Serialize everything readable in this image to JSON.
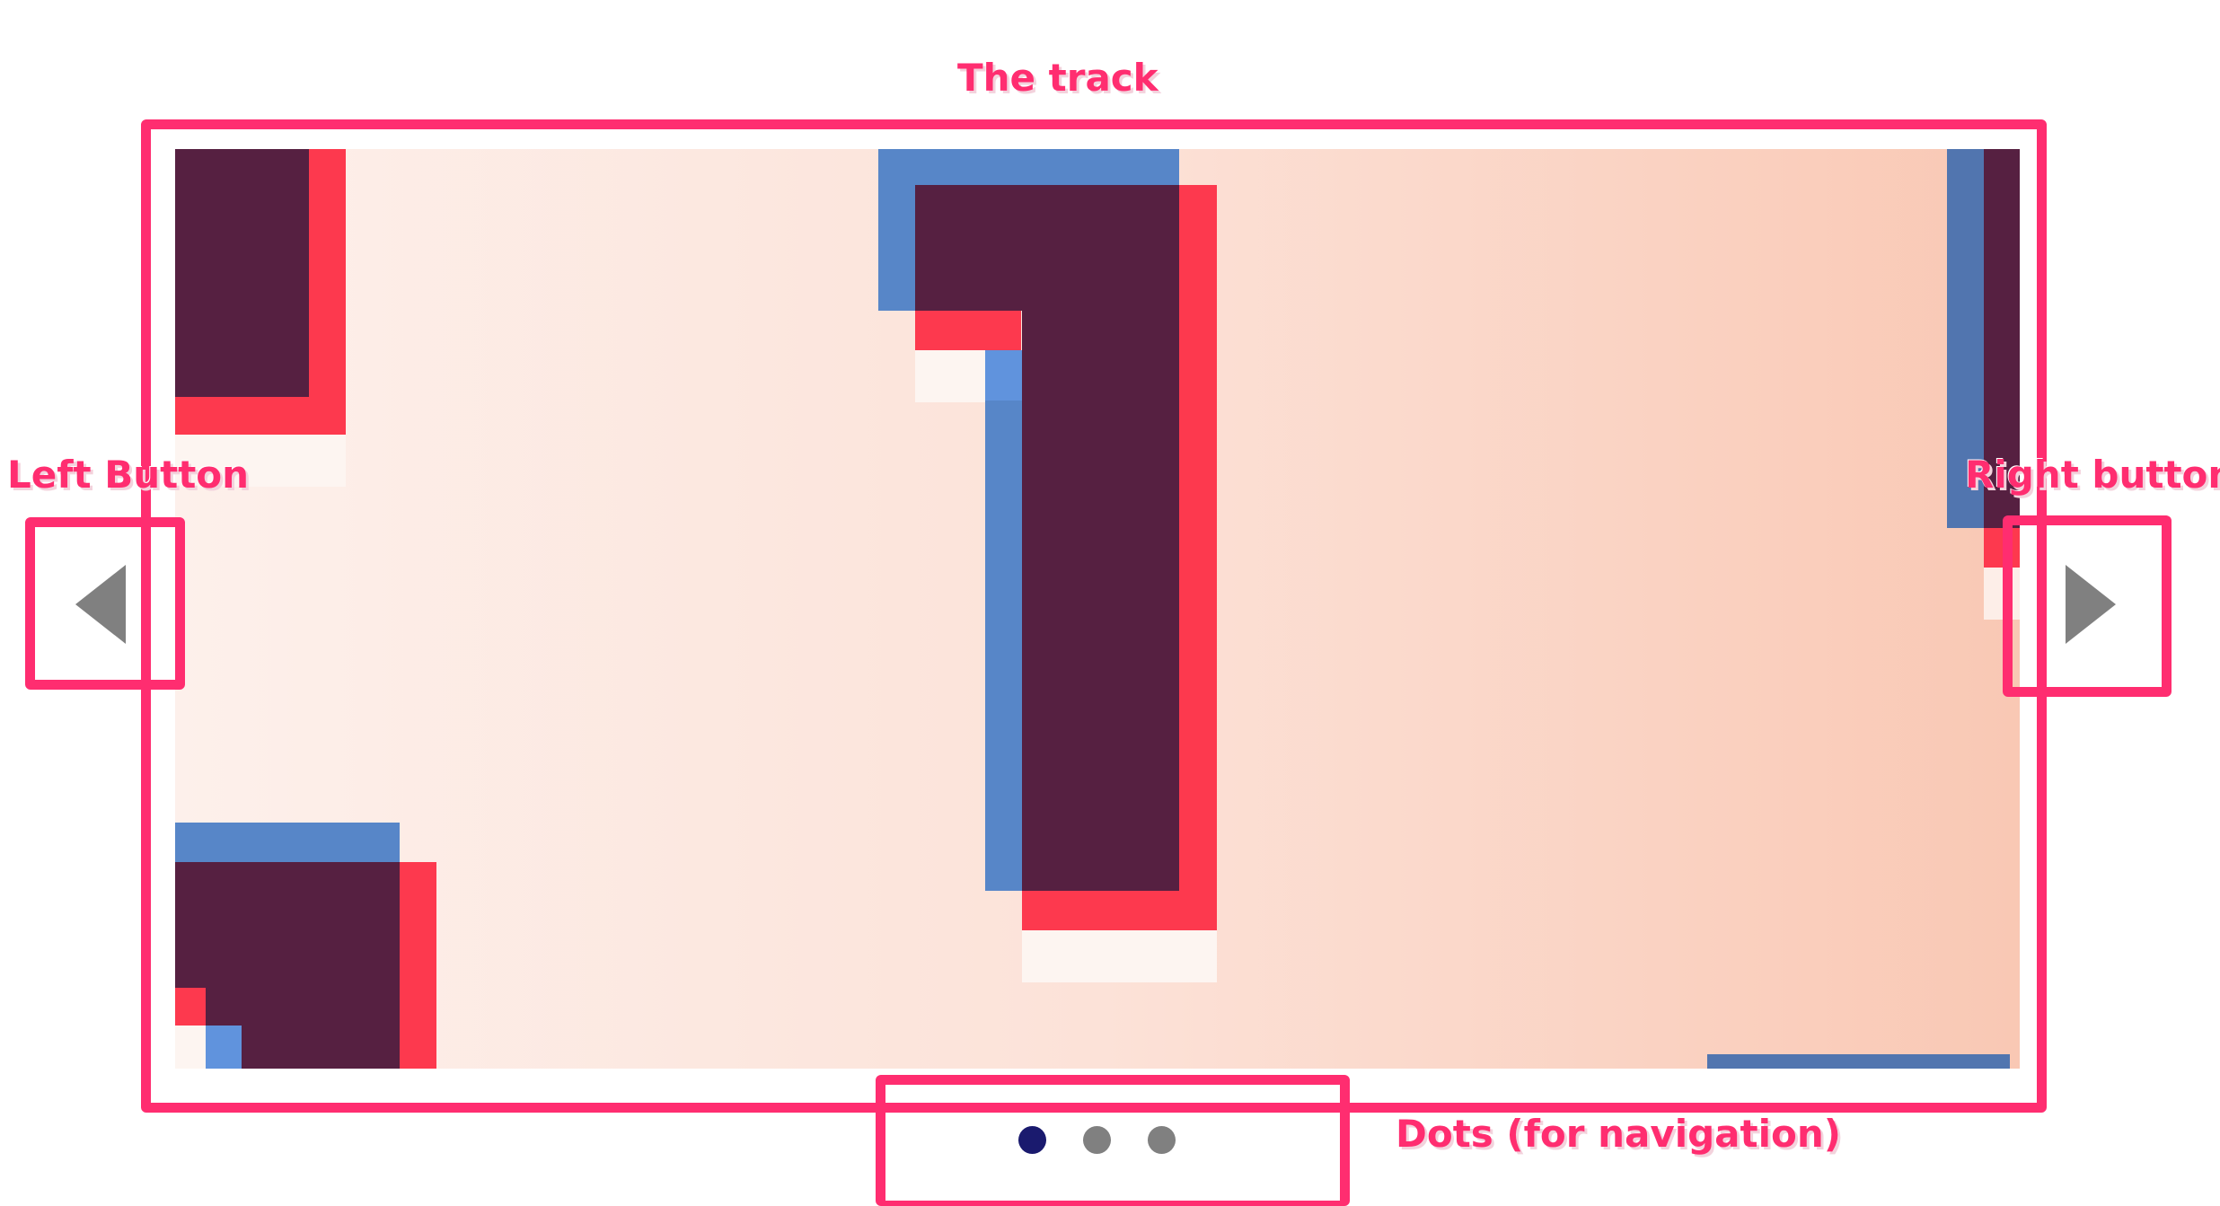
{
  "annotations": {
    "track": "The track",
    "left_button": "Left Button",
    "right_button": "Right button",
    "dots": "Dots (for navigation)"
  },
  "carousel": {
    "dots": {
      "count": 3,
      "active_index": 0,
      "active_color": "#1a1a6e",
      "inactive_color": "#808080"
    },
    "button_color": "#808080"
  },
  "colors": {
    "annotation_accent": "#ff2d70",
    "glyph_dark": "#562041",
    "glyph_red": "#fd394e",
    "glyph_blue": "#5786c8"
  }
}
